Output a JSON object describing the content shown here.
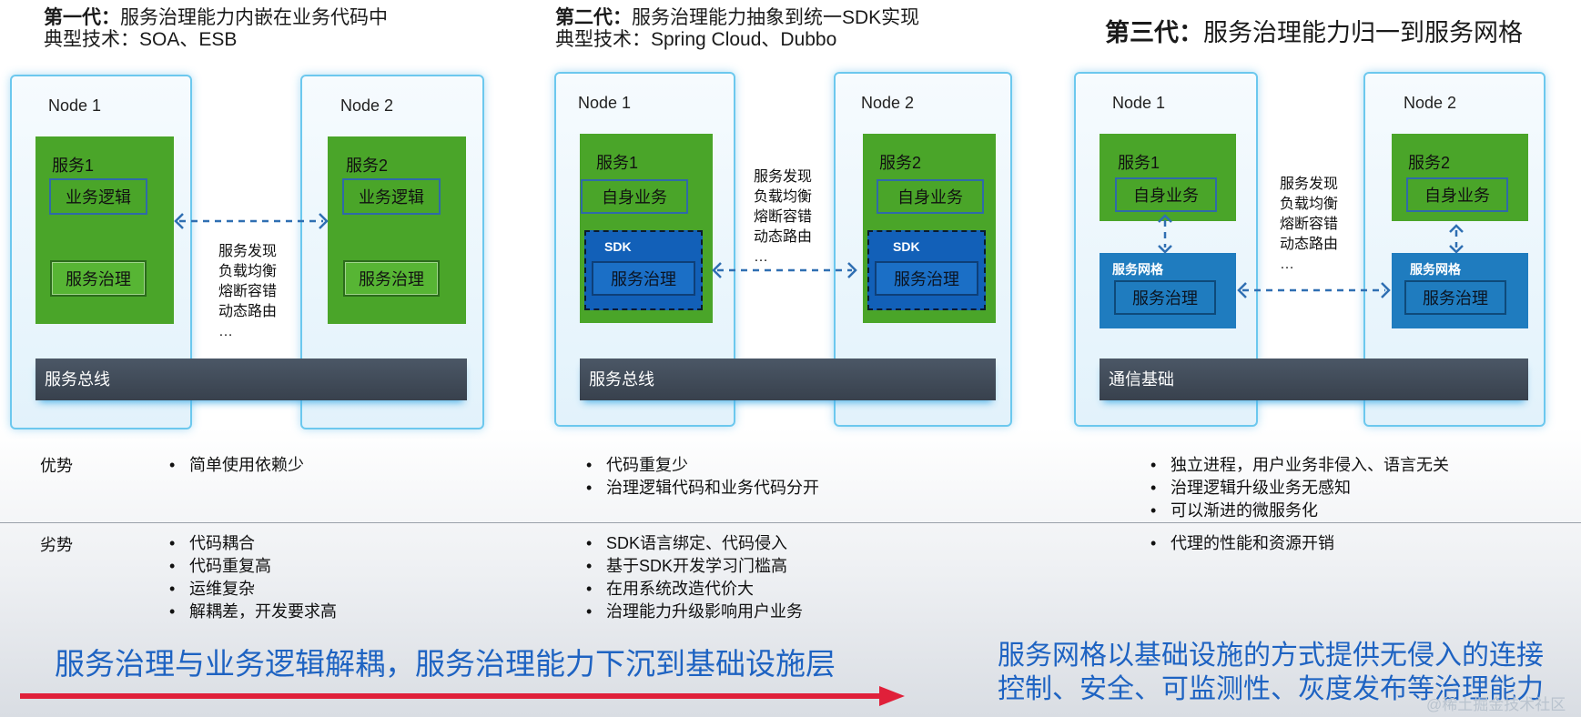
{
  "columns": [
    {
      "gen_label": "第一代：",
      "gen_title": "服务治理能力内嵌在业务代码中",
      "tech_label": "典型技术：",
      "tech": "SOA、ESB",
      "node1": {
        "title": "Node 1",
        "service": "服务1",
        "logic": "业务逻辑",
        "gov": "服务治理"
      },
      "node2": {
        "title": "Node 2",
        "service": "服务2",
        "logic": "业务逻辑",
        "gov": "服务治理"
      },
      "caps": [
        "服务发现",
        "负载均衡",
        "熔断容错",
        "动态路由",
        "…"
      ],
      "bus": "服务总线",
      "pros": [
        "简单使用依赖少"
      ],
      "cons": [
        "代码耦合",
        "代码重复高",
        "运维复杂",
        "解耦差，开发要求高"
      ]
    },
    {
      "gen_label": "第二代：",
      "gen_title": "服务治理能力抽象到统一SDK实现",
      "tech_label": "典型技术：",
      "tech": "Spring Cloud、Dubbo",
      "node1": {
        "title": "Node 1",
        "service": "服务1",
        "logic": "自身业务",
        "sdk": "SDK",
        "gov": "服务治理"
      },
      "node2": {
        "title": "Node 2",
        "service": "服务2",
        "logic": "自身业务",
        "sdk": "SDK",
        "gov": "服务治理"
      },
      "caps": [
        "服务发现",
        "负载均衡",
        "熔断容错",
        "动态路由",
        "…"
      ],
      "bus": "服务总线",
      "pros": [
        "代码重复少",
        "治理逻辑代码和业务代码分开"
      ],
      "cons": [
        "SDK语言绑定、代码侵入",
        "基于SDK开发学习门槛高",
        "在用系统改造代价大",
        "治理能力升级影响用户业务"
      ]
    },
    {
      "gen_label": "第三代：",
      "gen_title": "服务治理能力归一到服务网格",
      "node1": {
        "title": "Node 1",
        "service": "服务1",
        "logic": "自身业务",
        "mesh": "服务网格",
        "gov": "服务治理"
      },
      "node2": {
        "title": "Node 2",
        "service": "服务2",
        "logic": "自身业务",
        "mesh": "服务网格",
        "gov": "服务治理"
      },
      "caps": [
        "服务发现",
        "负载均衡",
        "熔断容错",
        "动态路由",
        "…"
      ],
      "bus": "通信基础",
      "pros": [
        "独立进程，用户业务非侵入、语言无关",
        "治理逻辑升级业务无感知",
        "可以渐进的微服务化"
      ],
      "cons": [
        "代理的性能和资源开销"
      ]
    }
  ],
  "rows": {
    "pros_label": "优势",
    "cons_label": "劣势"
  },
  "footer": {
    "left": "服务治理与业务逻辑解耦，服务治理能力下沉到基础设施层",
    "right_line1": "服务网格以基础设施的方式提供无侵入的连接",
    "right_line2": "控制、安全、可监测性、灰度发布等治理能力",
    "watermark": "@稀土掘金技术社区"
  },
  "colors": {
    "service_green": "#4aa529",
    "sdk_blue": "#1260b8",
    "mesh_blue": "#1f7cbf",
    "bus_gray": "#444e5a",
    "footer_text": "#1e63c2",
    "arrow_red": "#e0203a"
  }
}
